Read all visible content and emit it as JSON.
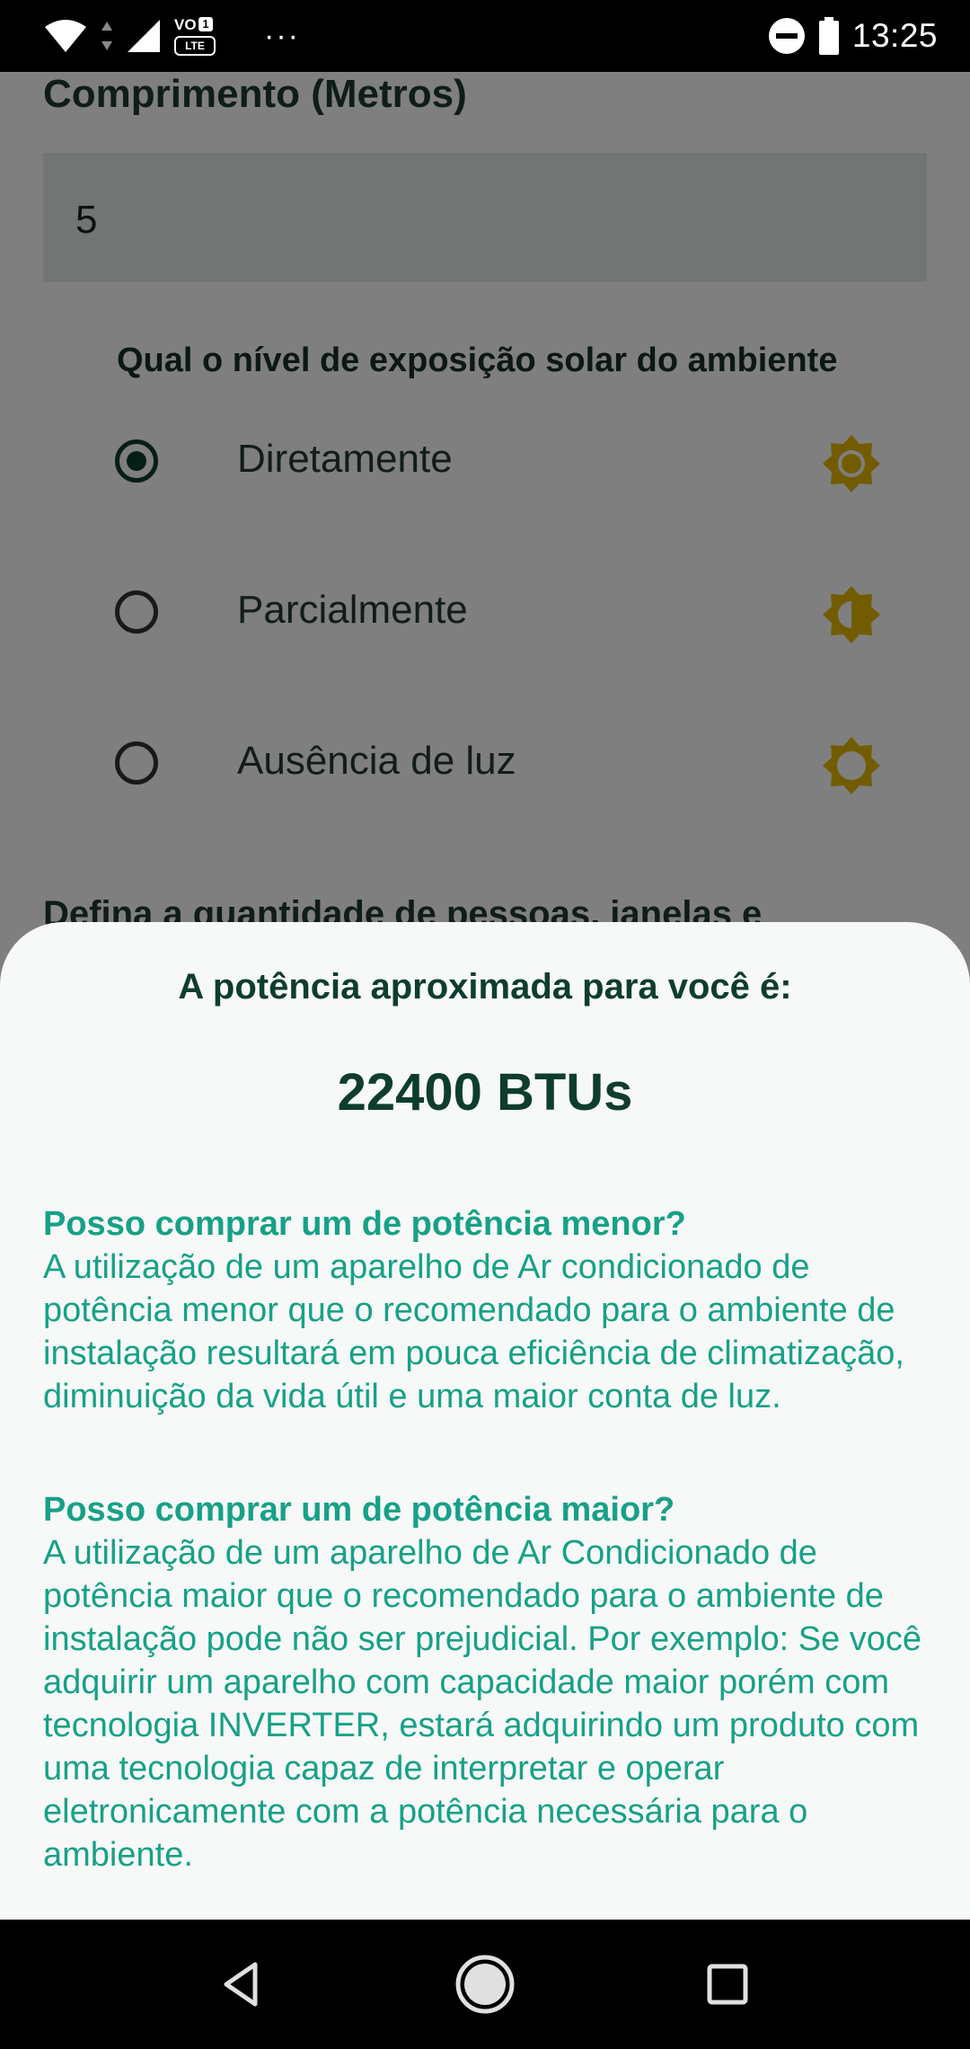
{
  "status_bar": {
    "time": "13:25",
    "volte_label": "VO",
    "volte_sim": "1",
    "lte_label": "LTE",
    "more_indicator": "···",
    "icons": [
      "wifi-icon",
      "signal-icon",
      "dnd-icon",
      "battery-icon"
    ]
  },
  "form": {
    "length_label": "Comprimento (Metros)",
    "length_value": "5",
    "sun_question": "Qual o nível de exposição solar do ambiente",
    "sun_options": [
      {
        "label": "Diretamente",
        "selected": true,
        "icon": "sun-full-icon"
      },
      {
        "label": "Parcialmente",
        "selected": false,
        "icon": "sun-half-icon"
      },
      {
        "label": "Ausência de luz",
        "selected": false,
        "icon": "sun-outline-icon"
      }
    ],
    "next_section_partial": "Defina a quantidade de pessoas, janelas e"
  },
  "result_sheet": {
    "title": "A potência aproximada para você é:",
    "value": "22400 BTUs",
    "faq": [
      {
        "question": "Posso comprar um de potência menor?",
        "answer": "A utilização de um aparelho de Ar condicionado de potência menor que o recomendado para o ambiente de instalação resultará em pouca eficiência de climatização, diminuição da vida útil e uma maior conta de luz."
      },
      {
        "question": "Posso comprar um de potência maior?",
        "answer": "A utilização de um aparelho de Ar Condicionado de potência maior que o recomendado para o ambiente de instalação pode não ser prejudicial. Por exemplo: Se você adquirir um aparelho com capacidade maior porém com tecnologia INVERTER, estará adquirindo um produto com uma tecnologia capaz de interpretar e operar eletronicamente com a potência necessária para o ambiente."
      }
    ]
  },
  "colors": {
    "dark_green": "#0e3d2f",
    "teal_text": "#17a187",
    "sun_gold": "#e6b800",
    "scrim": "rgba(0,0,0,0.5)"
  },
  "nav_bar": {
    "buttons": [
      "back-icon",
      "home-icon",
      "recents-icon"
    ]
  }
}
